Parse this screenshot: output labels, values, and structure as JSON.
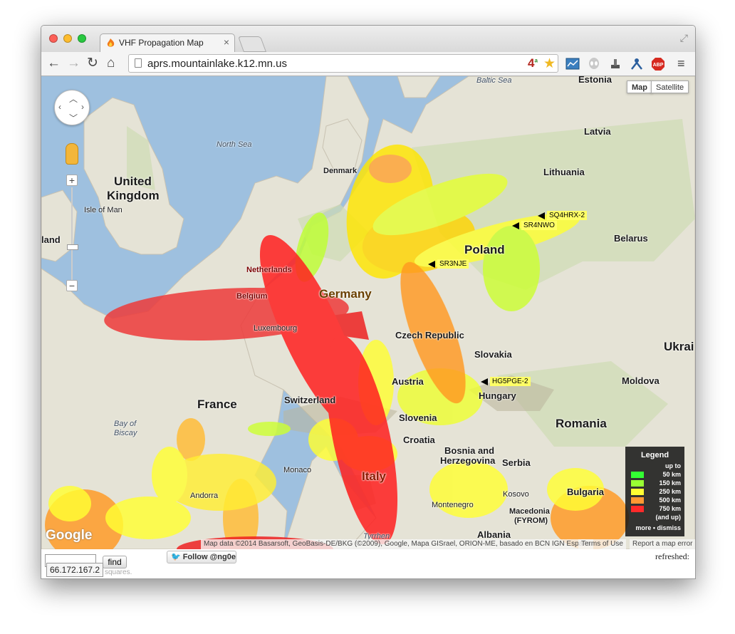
{
  "browser": {
    "tab_title": "VHF Propagation Map",
    "tab_close": "×",
    "url": "aprs.mountainlake.k12.mn.us",
    "badge_count": "4",
    "badge_sub": "a",
    "ext_abp": "ABP",
    "colors": {
      "close": "#fc5f57",
      "minimize": "#fdbc2e",
      "zoom": "#28c840"
    }
  },
  "map": {
    "controls": {
      "zoom_in": "+",
      "zoom_out": "−",
      "map_label": "Map",
      "satellite_label": "Satellite"
    },
    "labels": {
      "baltic_sea": "Baltic Sea",
      "estonia": "Estonia",
      "latvia": "Latvia",
      "lithuania": "Lithuania",
      "belarus": "Belarus",
      "denmark": "Denmark",
      "north_sea": "North Sea",
      "united": "United",
      "kingdom": "Kingdom",
      "isle_of_man": "Isle of Man",
      "ireland": "land",
      "netherlands": "Netherlands",
      "belgium": "Belgium",
      "luxembourg": "Luxembourg",
      "germany": "Germany",
      "poland": "Poland",
      "czech": "Czech Republic",
      "slovakia": "Slovakia",
      "austria": "Austria",
      "hungary": "Hungary",
      "ukraine": "Ukrai",
      "moldova": "Moldova",
      "romania": "Romania",
      "france": "France",
      "switzerland": "Switzerland",
      "slovenia": "Slovenia",
      "croatia": "Croatia",
      "bosnia1": "Bosnia and",
      "bosnia2": "Herzegovina",
      "serbia": "Serbia",
      "bay1": "Bay of",
      "bay2": "Biscay",
      "monaco": "Monaco",
      "andorra": "Andorra",
      "italy": "Italy",
      "montenegro": "Montenegro",
      "kosovo": "Kosovo",
      "macedonia1": "Macedonia",
      "macedonia2": "(FYROM)",
      "bulgaria": "Bulgaria",
      "albania": "Albania",
      "tyrrhenian": "Tyrrhen"
    },
    "callsigns": [
      "SQ4HRX-2",
      "SR4NWO",
      "SR3NJE",
      "HG5PGE-2"
    ],
    "legend": {
      "title": "Legend",
      "upto": "up to",
      "rows": [
        {
          "label": "50 km",
          "color": "#33ff33"
        },
        {
          "label": "150 km",
          "color": "#99ff33"
        },
        {
          "label": "250 km",
          "color": "#ffff33"
        },
        {
          "label": "500 km",
          "color": "#ff9933"
        },
        {
          "label": "750 km",
          "color": "#ff2a2a"
        }
      ],
      "and_up": "(and up)",
      "more_dismiss": "more • dismiss"
    },
    "google_logo": "Google",
    "attribution": "Map data ©2014 Basarsoft, GeoBasis-DE/BKG (©2009), Google, Mapa GISrael, ORION-ME, basado en BCN IGN España",
    "terms": "Terms of Use",
    "report": "Report a map error"
  },
  "footer": {
    "find_label": "find",
    "follow_label": "Follow @ng0e",
    "tooltip": "66.172.167.2",
    "squares": "squares.",
    "refreshed": "refreshed:"
  }
}
